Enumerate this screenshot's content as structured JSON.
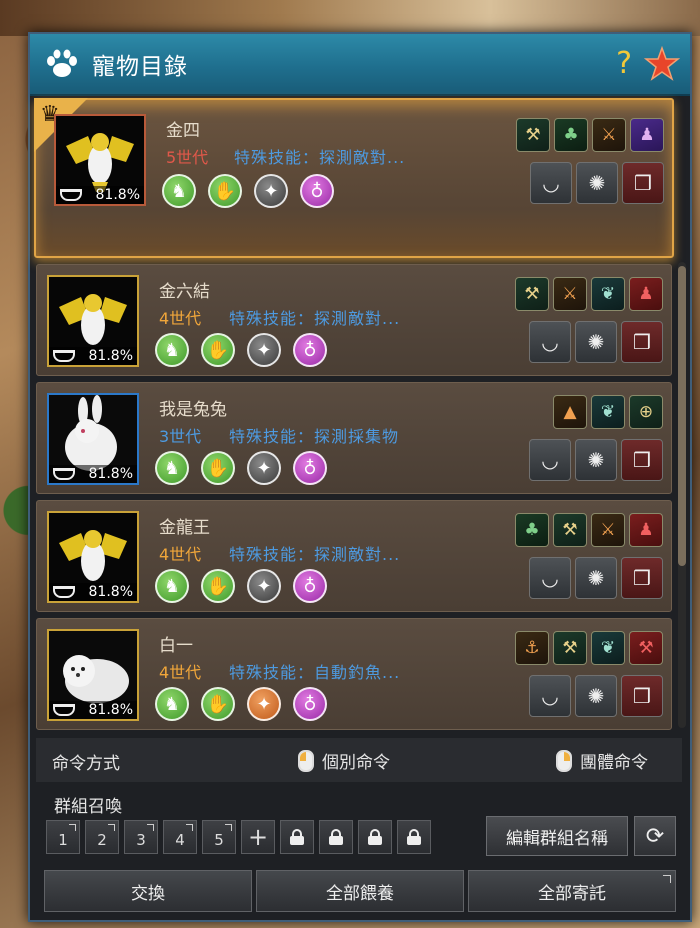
{
  "window": {
    "title": "寵物目錄",
    "help_label": "?"
  },
  "pets": [
    {
      "name": "金四",
      "generation": "5世代",
      "skill": "特殊技能：探測敵對...",
      "food_pct": "81.8%",
      "portrait": "golden-dragon",
      "selected": true,
      "skill_icons": [
        "pickaxe-icon",
        "clover-icon",
        "axe-icon",
        "purple-people-icon"
      ]
    },
    {
      "name": "金六結",
      "generation": "4世代",
      "skill": "特殊技能：探測敵對...",
      "food_pct": "81.8%",
      "portrait": "golden-dragon",
      "selected": false,
      "skill_icons": [
        "pickaxe-icon",
        "axe-icon",
        "wing-icon",
        "red-people-icon"
      ]
    },
    {
      "name": "我是兔兔",
      "generation": "3世代",
      "skill": "特殊技能：探測採集物",
      "food_pct": "81.8%",
      "portrait": "white-rabbit",
      "selected": false,
      "skill_icons": [
        "campfire-icon",
        "wing-icon",
        "crosshair-icon"
      ]
    },
    {
      "name": "金龍王",
      "generation": "4世代",
      "skill": "特殊技能：探測敵對...",
      "food_pct": "81.8%",
      "portrait": "golden-dragon",
      "selected": false,
      "skill_icons": [
        "clover-icon",
        "pickaxe-icon",
        "axe-icon",
        "red-people-icon"
      ]
    },
    {
      "name": "白一",
      "generation": "4世代",
      "skill": "特殊技能：自動釣魚...",
      "food_pct": "81.8%",
      "portrait": "white-seal",
      "selected": false,
      "skill_icons": [
        "fishing-rod-icon",
        "pickaxe-icon",
        "wing-icon",
        "pickaxe-red-icon"
      ]
    }
  ],
  "command": {
    "label": "命令方式",
    "individual": "個別命令",
    "group": "團體命令"
  },
  "group_summon": {
    "label": "群組召喚",
    "slots": [
      "1",
      "2",
      "3",
      "4",
      "5"
    ],
    "plus": "+",
    "edit_button": "編輯群組名稱"
  },
  "bottom": {
    "exchange": "交換",
    "feed_all": "全部餵養",
    "deposit_all": "全部寄託"
  }
}
